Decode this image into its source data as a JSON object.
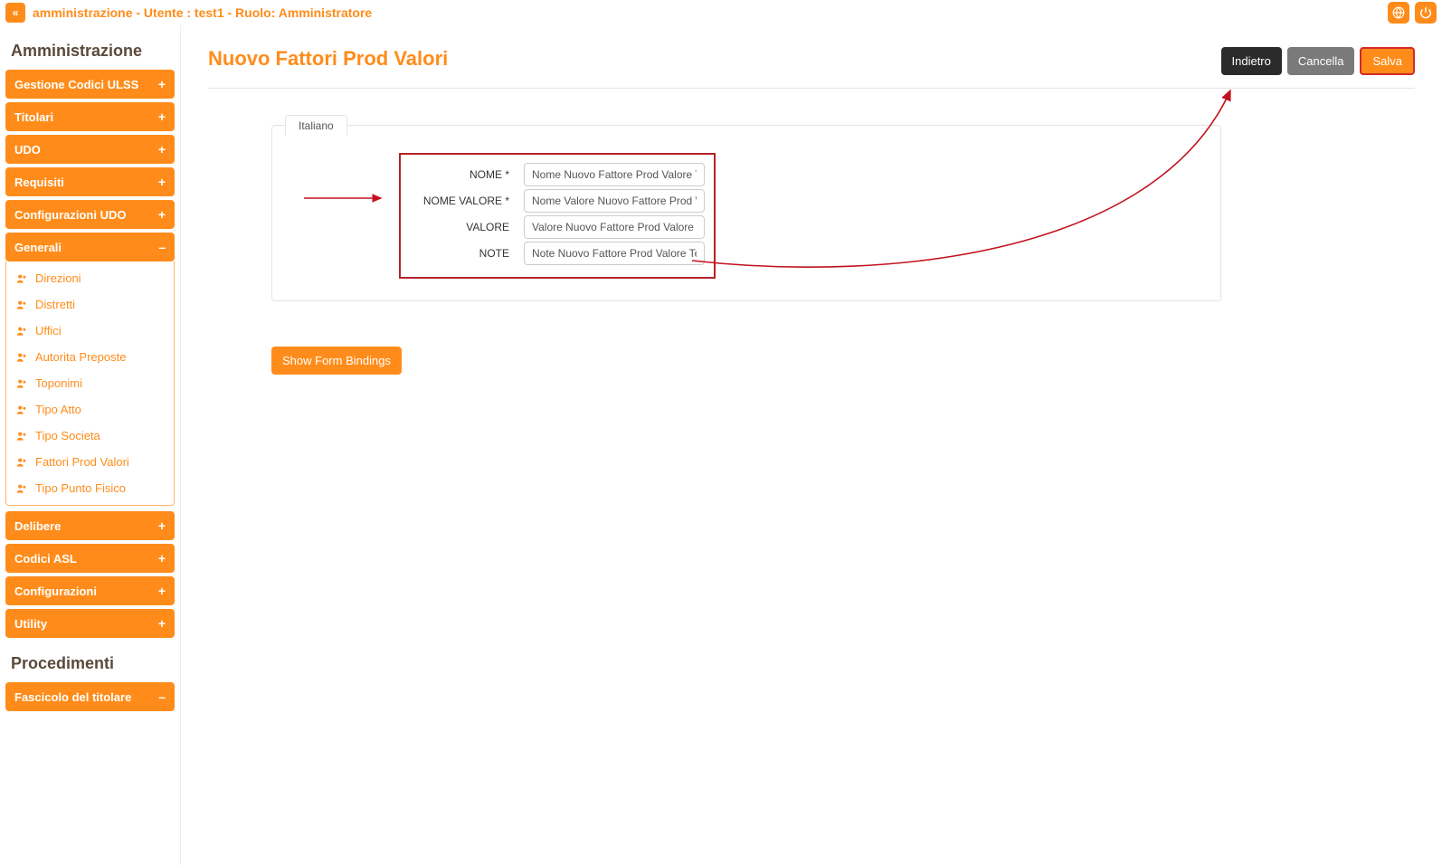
{
  "header": {
    "title": "amministrazione - Utente : test1 - Ruolo: Amministratore"
  },
  "sidebar": {
    "section1_title": "Amministrazione",
    "section2_title": "Procedimenti",
    "items": [
      {
        "label": "Gestione Codici ULSS",
        "expand": "+"
      },
      {
        "label": "Titolari",
        "expand": "+"
      },
      {
        "label": "UDO",
        "expand": "+"
      },
      {
        "label": "Requisiti",
        "expand": "+"
      },
      {
        "label": "Configurazioni UDO",
        "expand": "+"
      },
      {
        "label": "Generali",
        "expand": "–"
      },
      {
        "label": "Delibere",
        "expand": "+"
      },
      {
        "label": "Codici ASL",
        "expand": "+"
      },
      {
        "label": "Configurazioni",
        "expand": "+"
      },
      {
        "label": "Utility",
        "expand": "+"
      },
      {
        "label": "Fascicolo del titolare",
        "expand": "–"
      }
    ],
    "generali_sub": [
      {
        "label": "Direzioni"
      },
      {
        "label": "Distretti"
      },
      {
        "label": "Uffici"
      },
      {
        "label": "Autorita Preposte"
      },
      {
        "label": "Toponimi"
      },
      {
        "label": "Tipo Atto"
      },
      {
        "label": "Tipo Societa"
      },
      {
        "label": "Fattori Prod Valori"
      },
      {
        "label": "Tipo Punto Fisico"
      }
    ]
  },
  "page": {
    "title": "Nuovo Fattori Prod Valori",
    "back_label": "Indietro",
    "cancel_label": "Cancella",
    "save_label": "Salva",
    "tab_label": "Italiano",
    "show_bindings_label": "Show Form Bindings",
    "fields": [
      {
        "label": "NOME *",
        "value": "Nome Nuovo Fattore Prod Valore Tes"
      },
      {
        "label": "NOME VALORE *",
        "value": "Nome Valore Nuovo Fattore Prod Val"
      },
      {
        "label": "VALORE",
        "value": "Valore Nuovo Fattore Prod Valore Tes"
      },
      {
        "label": "NOTE",
        "value": "Note Nuovo Fattore Prod Valore Test"
      }
    ]
  }
}
